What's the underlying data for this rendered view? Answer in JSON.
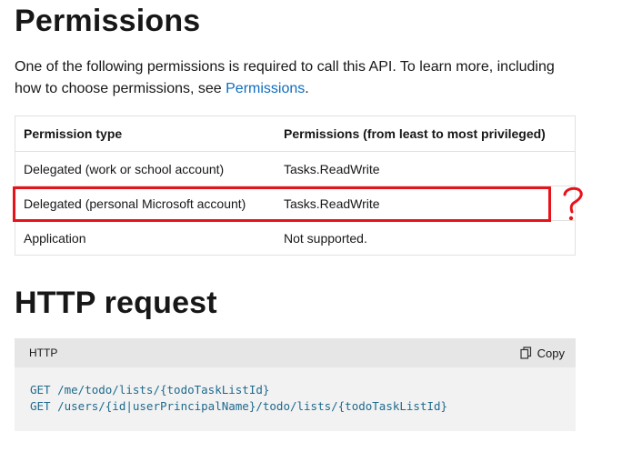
{
  "permissions_section": {
    "title": "Permissions",
    "intro_text": "One of the following permissions is required to call this API. To learn more, including how to choose permissions, see ",
    "intro_link": "Permissions",
    "intro_end": ".",
    "table": {
      "headers": [
        "Permission type",
        "Permissions (from least to most privileged)"
      ],
      "rows": [
        [
          "Delegated (work or school account)",
          "Tasks.ReadWrite"
        ],
        [
          "Delegated (personal Microsoft account)",
          "Tasks.ReadWrite"
        ],
        [
          "Application",
          "Not supported."
        ]
      ]
    },
    "annotation": {
      "symbol": "?",
      "color": "#e8121b"
    }
  },
  "http_section": {
    "title": "HTTP request",
    "code_language": "HTTP",
    "copy_label": "Copy",
    "code_lines": [
      "GET /me/todo/lists/{todoTaskListId}",
      "GET /users/{id|userPrincipalName}/todo/lists/{todoTaskListId}"
    ]
  },
  "colors": {
    "link": "#0f6cbd",
    "code_text": "#1e6a8d",
    "annotation_red": "#e8121b"
  }
}
